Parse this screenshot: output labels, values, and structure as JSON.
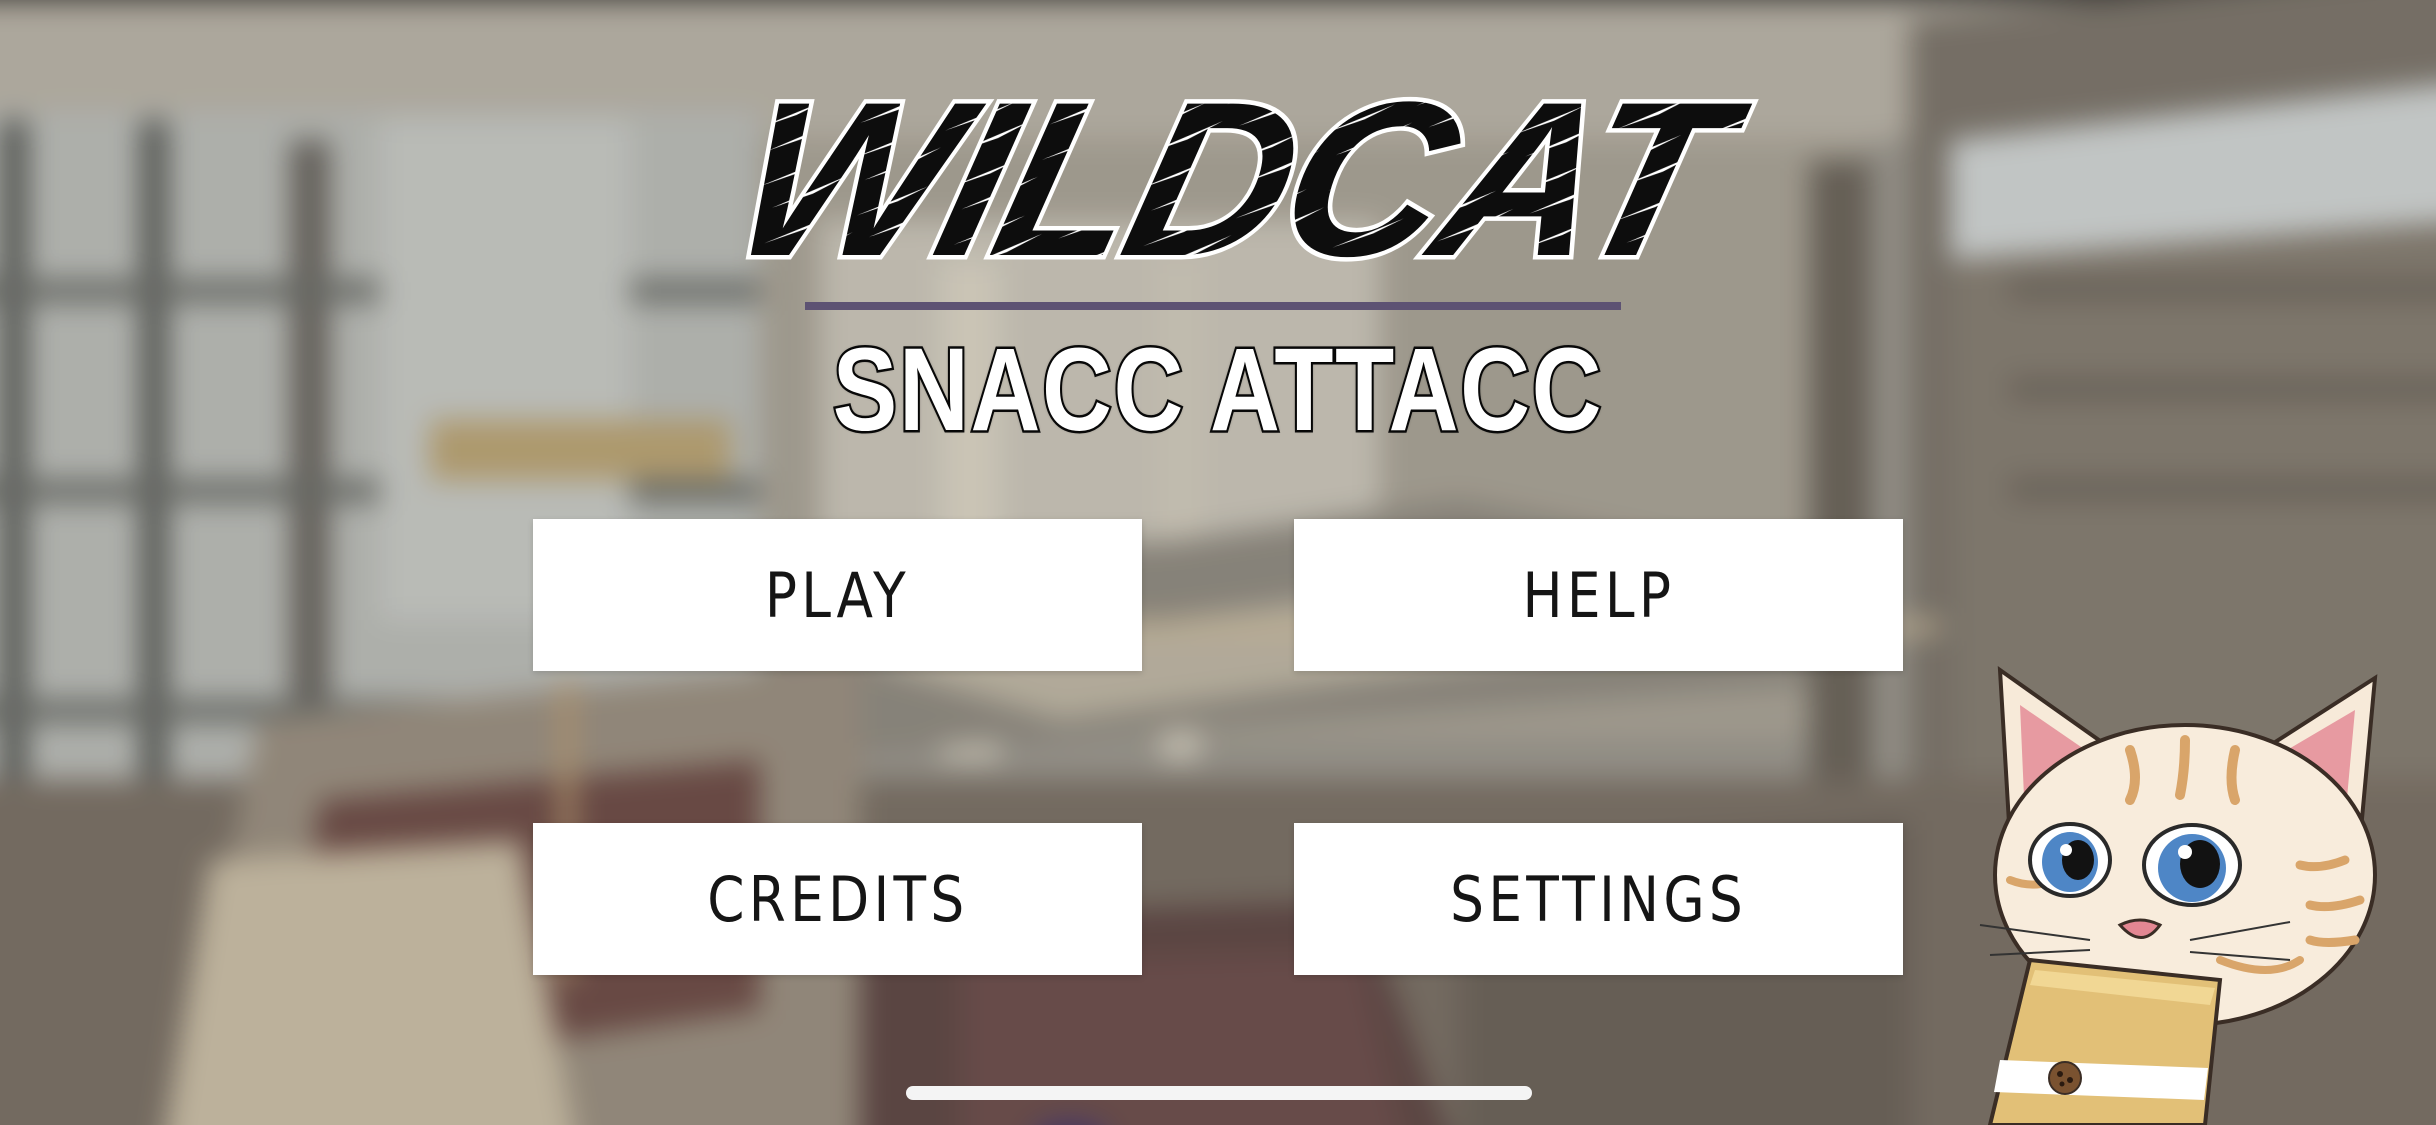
{
  "game": {
    "logo_text": "WILDCAT",
    "subtitle": "SNACC ATTACC"
  },
  "menu": {
    "play": "PLAY",
    "help": "HELP",
    "credits": "CREDITS",
    "settings": "SETTINGS"
  },
  "mascot": {
    "icon": "cat-mascot-with-snack-bag"
  },
  "colors": {
    "divider": "#5d5273",
    "button_bg": "#ffffff",
    "button_text": "#151515",
    "logo_fill": "#0d0d0d",
    "logo_outline": "#ffffff"
  }
}
